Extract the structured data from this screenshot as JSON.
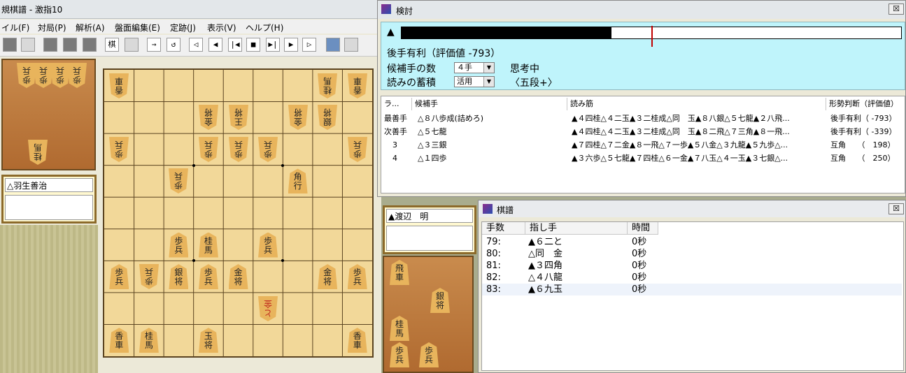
{
  "main": {
    "title": "規棋譜 - 激指10",
    "menu": [
      "イル(F)",
      "対局(P)",
      "解析(A)",
      "盤面編集(E)",
      "定跡(J)",
      "表示(V)",
      "ヘルプ(H)"
    ]
  },
  "players": {
    "gote_name": "△羽生善治",
    "sente_name": "▲渡辺　明"
  },
  "board": {
    "pieces": [
      {
        "c": 0,
        "r": 0,
        "t": "香\n車",
        "g": true
      },
      {
        "c": 7,
        "r": 0,
        "t": "桂\n馬",
        "g": true
      },
      {
        "c": 8,
        "r": 0,
        "t": "香\n車",
        "g": true
      },
      {
        "c": 3,
        "r": 1,
        "t": "金\n将",
        "g": true
      },
      {
        "c": 4,
        "r": 1,
        "t": "王\n将",
        "g": true
      },
      {
        "c": 6,
        "r": 1,
        "t": "金\n将",
        "g": true
      },
      {
        "c": 7,
        "r": 1,
        "t": "銀\n将",
        "g": true
      },
      {
        "c": 0,
        "r": 2,
        "t": "歩\n兵",
        "g": true
      },
      {
        "c": 3,
        "r": 2,
        "t": "歩\n兵",
        "g": true
      },
      {
        "c": 4,
        "r": 2,
        "t": "歩\n兵",
        "g": true
      },
      {
        "c": 5,
        "r": 2,
        "t": "歩\n兵",
        "g": true
      },
      {
        "c": 8,
        "r": 2,
        "t": "歩\n兵",
        "g": true
      },
      {
        "c": 2,
        "r": 3,
        "t": "歩\n兵",
        "g": true
      },
      {
        "c": 6,
        "r": 3,
        "t": "角\n行",
        "g": false
      },
      {
        "c": 2,
        "r": 5,
        "t": "歩\n兵",
        "g": false
      },
      {
        "c": 3,
        "r": 5,
        "t": "桂\n馬",
        "g": false
      },
      {
        "c": 5,
        "r": 5,
        "t": "歩\n兵",
        "g": false
      },
      {
        "c": 0,
        "r": 6,
        "t": "歩\n兵",
        "g": false
      },
      {
        "c": 1,
        "r": 6,
        "t": "歩\n兵",
        "g": true
      },
      {
        "c": 2,
        "r": 6,
        "t": "銀\n将",
        "g": false
      },
      {
        "c": 3,
        "r": 6,
        "t": "歩\n兵",
        "g": false
      },
      {
        "c": 4,
        "r": 6,
        "t": "金\n将",
        "g": false
      },
      {
        "c": 7,
        "r": 6,
        "t": "金\n将",
        "g": false
      },
      {
        "c": 8,
        "r": 6,
        "t": "歩\n兵",
        "g": false
      },
      {
        "c": 5,
        "r": 7,
        "t": "と\n金",
        "g": true,
        "red": true
      },
      {
        "c": 0,
        "r": 8,
        "t": "香\n車",
        "g": false
      },
      {
        "c": 1,
        "r": 8,
        "t": "桂\n馬",
        "g": false
      },
      {
        "c": 3,
        "r": 8,
        "t": "玉\n将",
        "g": false
      },
      {
        "c": 8,
        "r": 8,
        "t": "香\n車",
        "g": false
      }
    ],
    "gote_hand": [
      "歩\n兵",
      "歩\n兵",
      "歩\n兵",
      "歩\n兵",
      "桂\n馬"
    ],
    "sente_hand": [
      "飛\n車",
      "銀\n将",
      "桂\n馬",
      "歩\n兵",
      "歩\n兵"
    ]
  },
  "kentou": {
    "title": "検討",
    "eval_fraction": 0.42,
    "eval_marker_fraction": 0.5,
    "status": "後手有利（評価値 -793）",
    "cand_label": "候補手の数",
    "cand_value": "４手",
    "thinking": "思考中",
    "store_label": "読みの蓄積",
    "store_value": "活用",
    "level": "〈五段+〉",
    "headers": [
      "ラ...",
      "候補手",
      "読み筋",
      "形勢判断（評価値）"
    ],
    "rows": [
      {
        "rank": "最善手",
        "move": "△８八歩成(詰めろ)",
        "line": "▲４四桂△４二玉▲３二桂成△同　玉▲８八銀△５七龍▲２八飛...",
        "judge": "後手有利（ -793）"
      },
      {
        "rank": "次善手",
        "move": "△５七龍",
        "line": "▲４四桂△４二玉▲３二桂成△同　玉▲８二飛△７三角▲８一飛...",
        "judge": "後手有利（ -339）"
      },
      {
        "rank": "3",
        "move": "△３三銀",
        "line": "▲７四桂△７二金▲８一飛△７一歩▲５八金△３九龍▲５九歩△...",
        "judge": "互角　　（　198）"
      },
      {
        "rank": "4",
        "move": "△１四歩",
        "line": "▲３六歩△５七龍▲７四桂△６一金▲７八玉△４一玉▲３七銀△...",
        "judge": "互角　　（　250）"
      }
    ]
  },
  "kifu": {
    "title": "棋譜",
    "close": "☒",
    "headers": [
      "手数",
      "指し手",
      "時間"
    ],
    "rows": [
      {
        "n": "79:",
        "move": "▲６二と",
        "time": "0秒"
      },
      {
        "n": "80:",
        "move": "△同　金",
        "time": "0秒"
      },
      {
        "n": "81:",
        "move": "▲３四角",
        "time": "0秒"
      },
      {
        "n": "82:",
        "move": "△４八龍",
        "time": "0秒"
      },
      {
        "n": "83:",
        "move": "▲６九玉",
        "time": "0秒"
      }
    ]
  },
  "toolbar": {
    "labels": [
      "棋",
      "→",
      "↺",
      "◁",
      "◀",
      "|◀",
      "■",
      "▶|",
      "▶",
      "▷"
    ]
  }
}
